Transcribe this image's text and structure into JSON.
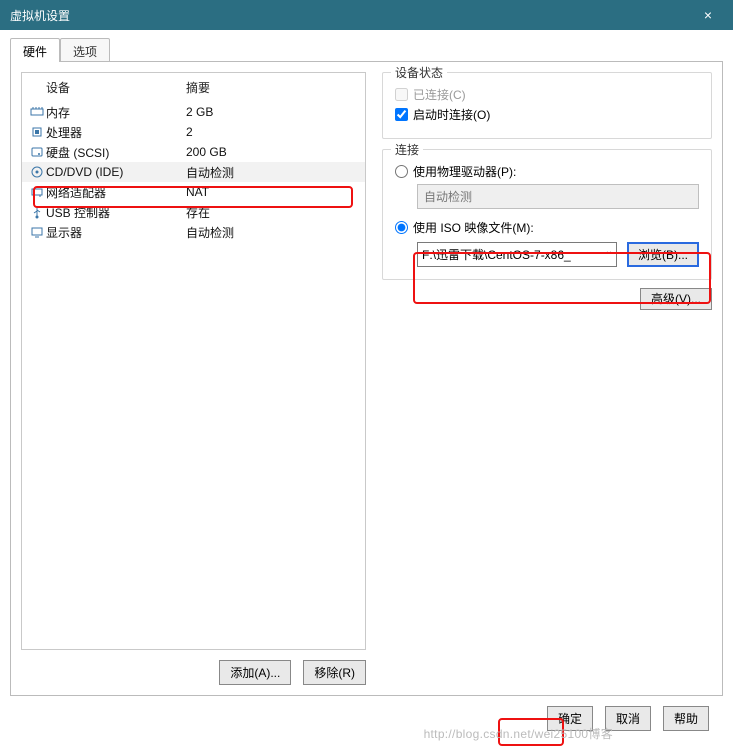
{
  "window": {
    "title": "虚拟机设置",
    "close": "×"
  },
  "tabs": {
    "hardware": "硬件",
    "options": "选项"
  },
  "devlist": {
    "col_device": "设备",
    "col_summary": "摘要",
    "rows": [
      {
        "name": "内存",
        "summary": "2 GB"
      },
      {
        "name": "处理器",
        "summary": "2"
      },
      {
        "name": "硬盘 (SCSI)",
        "summary": "200 GB"
      },
      {
        "name": "CD/DVD (IDE)",
        "summary": "自动检测"
      },
      {
        "name": "网络适配器",
        "summary": "NAT"
      },
      {
        "name": "USB 控制器",
        "summary": "存在"
      },
      {
        "name": "显示器",
        "summary": "自动检测"
      }
    ],
    "add_btn": "添加(A)...",
    "remove_btn": "移除(R)"
  },
  "right": {
    "status_title": "设备状态",
    "connected": "已连接(C)",
    "connect_at_start": "启动时连接(O)",
    "conn_title": "连接",
    "use_physical": "使用物理驱动器(P):",
    "physical_combo": "自动检测",
    "use_iso": "使用 ISO 映像文件(M):",
    "iso_path": "F:\\迅雷下载\\CentOS-7-x86_",
    "browse": "浏览(B)...",
    "advanced": "高级(V)..."
  },
  "footer": {
    "ok": "确定",
    "cancel": "取消",
    "help": "帮助"
  },
  "watermark": "http://blog.csdn.net/wei25100博客"
}
